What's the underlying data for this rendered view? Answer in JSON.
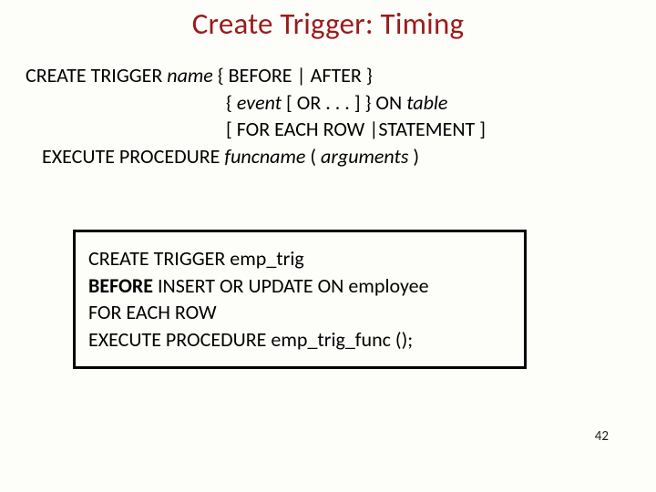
{
  "title": "Create Trigger: Timing",
  "syntax": {
    "l1_a": "CREATE TRIGGER ",
    "l1_name": "name",
    "l1_b": "  { BEFORE | AFTER }",
    "l2_a": "{ ",
    "l2_event": "event",
    "l2_b": " [ OR . . . ] } ON ",
    "l2_table": "table",
    "l3": "[ FOR EACH ROW |STATEMENT ]",
    "l4_a": "EXECUTE PROCEDURE ",
    "l4_func": "funcname",
    "l4_b": " ( ",
    "l4_args": "arguments",
    "l4_c": " )"
  },
  "example": {
    "l1": "CREATE TRIGGER emp_trig",
    "l2_bold": "BEFORE",
    "l2_rest": " INSERT OR UPDATE ON employee",
    "l3": "FOR EACH ROW",
    "l4": "EXECUTE PROCEDURE emp_trig_func ();"
  },
  "page_number": "42"
}
